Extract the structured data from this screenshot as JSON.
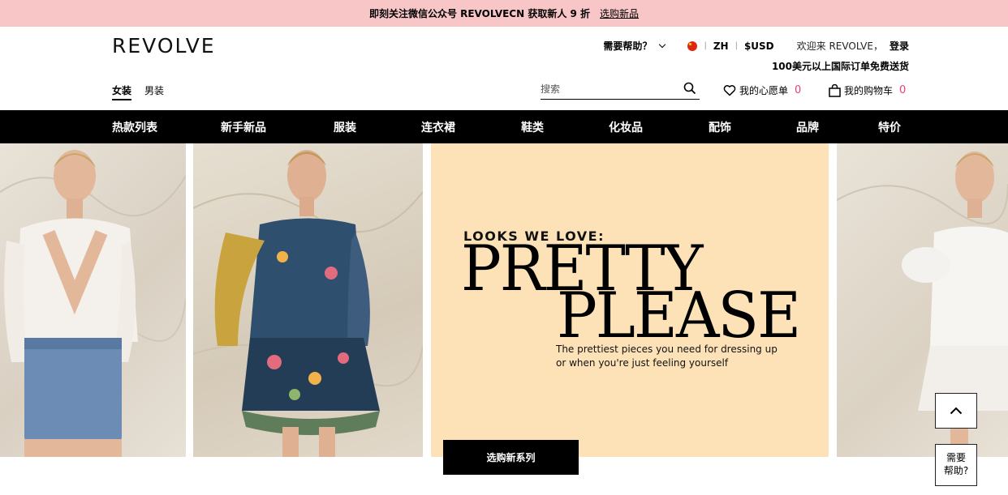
{
  "promo": {
    "text": "即刻关注微信公众号 REVOLVECN 获取新人 9 折",
    "link": "选购新品"
  },
  "header": {
    "logo": "REVOLVE",
    "help": "需要帮助？",
    "language": "ZH",
    "currency": "$USD",
    "welcome": "欢迎来 REVOLVE，",
    "login": "登录",
    "shipping": "100美元以上国际订单免费送货",
    "gender_tabs": [
      {
        "label": "女装",
        "active": true
      },
      {
        "label": "男装",
        "active": false
      }
    ],
    "search": {
      "placeholder": "搜索",
      "value": ""
    },
    "wishlist": {
      "label": "我的心愿单",
      "count": "0"
    },
    "cart": {
      "label": "我的购物车",
      "count": "0"
    }
  },
  "nav": {
    "items": [
      "热款列表",
      "新手新品",
      "服装",
      "连衣裙",
      "鞋类",
      "化妆品",
      "配饰",
      "品牌",
      "特价"
    ]
  },
  "hero": {
    "kicker": "LOOKS WE LOVE:",
    "title_line1": "PRETTY",
    "title_line2": "PLEASE",
    "subtitle_line1": "The prettiest pieces you need for dressing up",
    "subtitle_line2": "or when you're just feeling yourself",
    "cta": "选购新系列"
  },
  "floating": {
    "help_line1": "需要",
    "help_line2": "帮助?"
  },
  "colors": {
    "promo_bg": "#f9c6c8",
    "nav_bg": "#000000",
    "banner_bg": "#fde2b8",
    "count_accent": "#e2417a"
  }
}
